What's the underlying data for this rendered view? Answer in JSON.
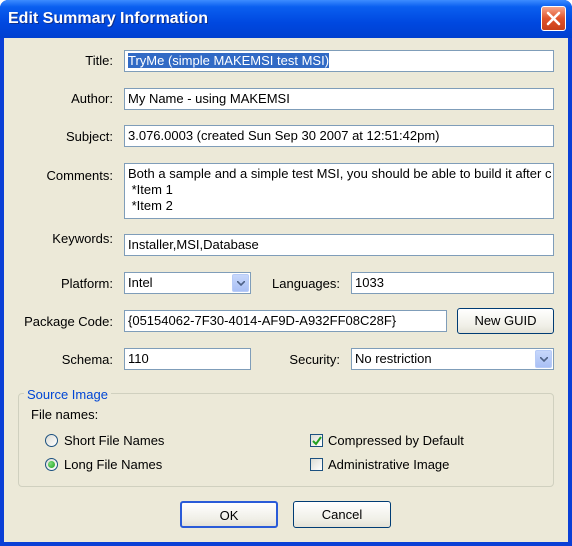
{
  "window": {
    "title": "Edit Summary Information"
  },
  "fields": {
    "title": {
      "label": "Title:",
      "value": "TryMe (simple MAKEMSI test MSI)"
    },
    "author": {
      "label": "Author:",
      "value": "My Name - using MAKEMSI"
    },
    "subject": {
      "label": "Subject:",
      "value": "3.076.0003 (created Sun Sep 30 2007 at 12:51:42pm)"
    },
    "comments": {
      "label": "Comments:",
      "lines": [
        "Both a sample and a simple test MSI, you should be able to build it after c",
        " *Item 1",
        " *Item 2"
      ]
    },
    "keywords": {
      "label": "Keywords:",
      "value": "Installer,MSI,Database"
    },
    "platform": {
      "label": "Platform:",
      "value": "Intel"
    },
    "languages": {
      "label": "Languages:",
      "value": "1033"
    },
    "package_code": {
      "label": "Package Code:",
      "value": "{05154062-7F30-4014-AF9D-A932FF08C28F}"
    },
    "schema": {
      "label": "Schema:",
      "value": "110"
    },
    "security": {
      "label": "Security:",
      "value": "No restriction"
    }
  },
  "buttons": {
    "new_guid": "New GUID",
    "ok": "OK",
    "cancel": "Cancel"
  },
  "source_image": {
    "group_title": "Source Image",
    "file_names_label": "File names:",
    "short_names": {
      "label": "Short File Names",
      "selected": false
    },
    "long_names": {
      "label": "Long File Names",
      "selected": true
    },
    "compressed": {
      "label": "Compressed by Default",
      "checked": true
    },
    "administrative": {
      "label": "Administrative Image",
      "checked": false
    }
  },
  "colors": {
    "titlebar": "#0040d0",
    "dialog_bg": "#ece9d8",
    "group_title": "#0046d5",
    "selection": "#316ac5"
  }
}
